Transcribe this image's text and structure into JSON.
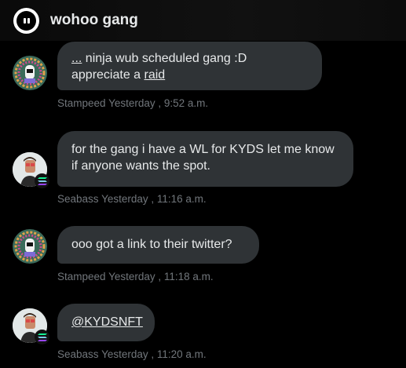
{
  "chat": {
    "title": "wohoo gang"
  },
  "messages": [
    {
      "sender": "Stampeed",
      "text_prefix": "...",
      "text_middle": " ninja wub scheduled gang :D appreciate a ",
      "text_link": "raid",
      "timestamp": "Yesterday , 9:52 a.m."
    },
    {
      "sender": "Seabass",
      "text": "for the gang i have a WL for KYDS let me know if anyone wants the spot.",
      "timestamp": "Yesterday , 11:16 a.m."
    },
    {
      "sender": "Stampeed",
      "text": "ooo got a link to their twitter?",
      "timestamp": "Yesterday , 11:18 a.m."
    },
    {
      "sender": "Seabass",
      "mention": "@KYDSNFT",
      "timestamp": "Yesterday , 11:20 a.m."
    }
  ],
  "colors": {
    "bubble": "#2f3336",
    "meta": "#71767b",
    "background": "#000000"
  },
  "icons": {
    "group": "group-avatar-icon",
    "solana": "solana-badge-icon"
  }
}
